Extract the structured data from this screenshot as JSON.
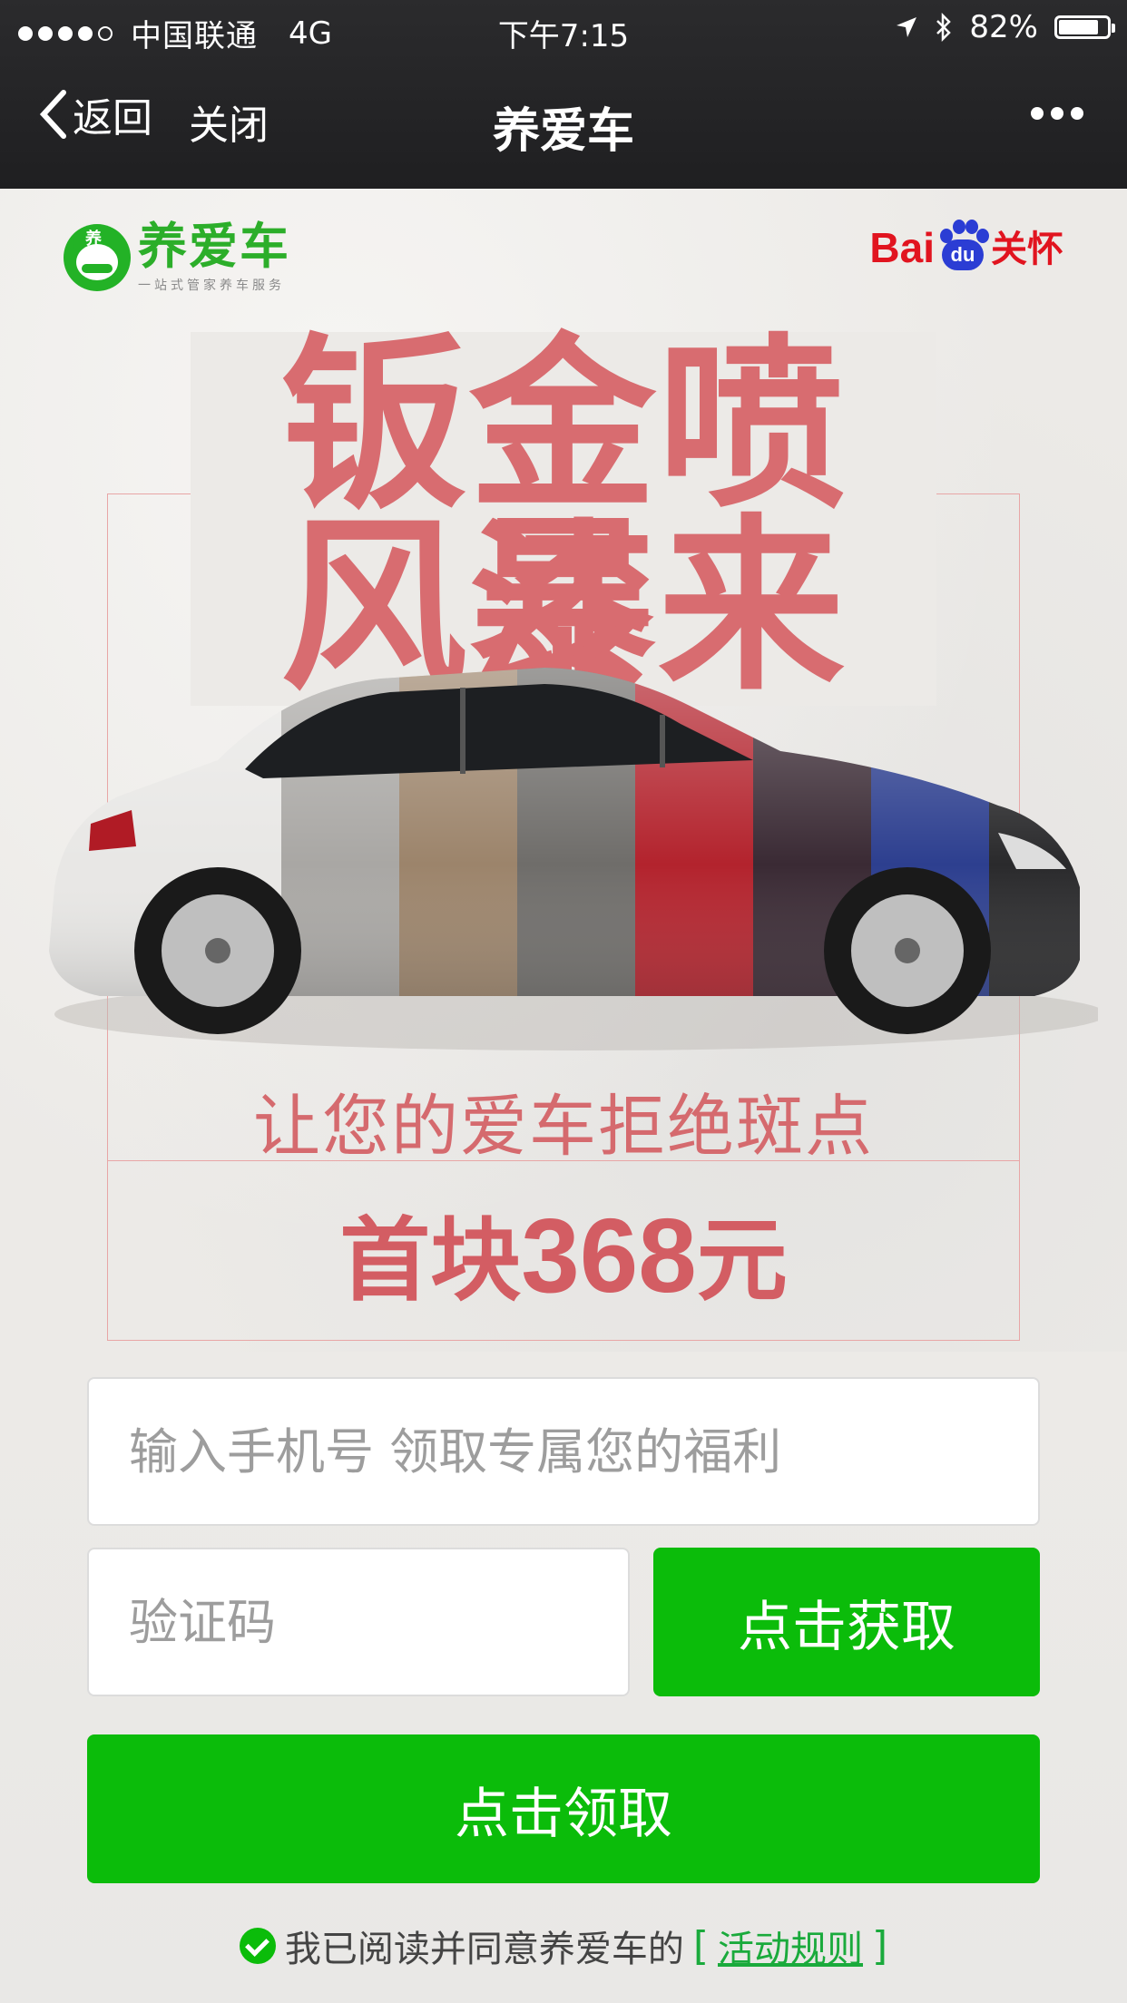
{
  "status_bar": {
    "carrier": "中国联通",
    "network": "4G",
    "time": "下午7:15",
    "battery": "82%",
    "battery_level": 0.82
  },
  "nav": {
    "back_label": "返回",
    "close_label": "关闭",
    "title": "养爱车"
  },
  "banner": {
    "brand_name": "养爱车",
    "brand_slogan": "一站式管家养车服务",
    "partner_baidu": "Bai",
    "partner_du": "du",
    "partner_tag": "关怀",
    "headline_1": "钣金喷漆",
    "headline_2": "风暴来袭",
    "tagline": "让您的爱车拒绝斑点",
    "price_prefix": "首块",
    "price_num": "368",
    "price_unit": "元"
  },
  "form": {
    "phone_placeholder": "输入手机号 领取专属您的福利",
    "code_placeholder": "验证码",
    "get_code_label": "点击获取",
    "claim_label": "点击领取",
    "agree_text": "我已阅读并同意养爱车的",
    "bracket_open": "[",
    "rules_link": "活动规则",
    "bracket_close": "]"
  },
  "colors": {
    "accent_green": "#0bbc0a",
    "headline_red": "#d86c70",
    "brand_green": "#2cae2a",
    "baidu_red": "#e1141f",
    "baidu_blue": "#2b3dd4"
  }
}
